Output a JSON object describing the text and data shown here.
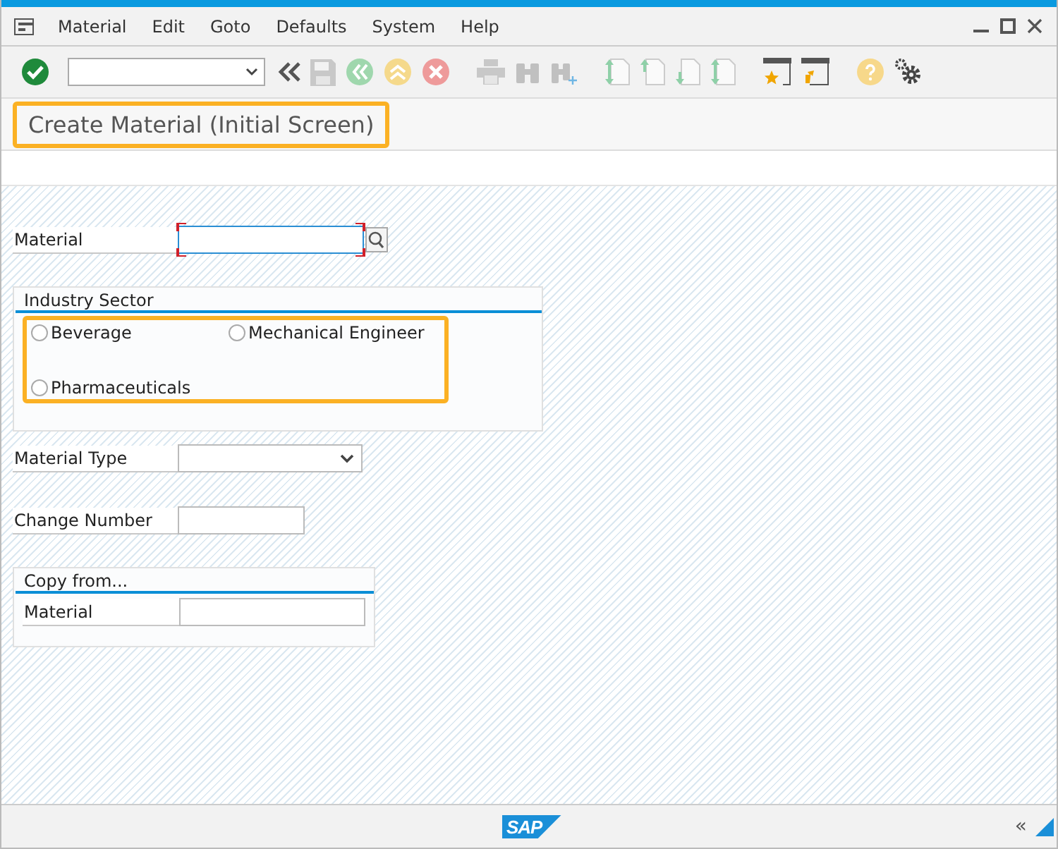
{
  "menu_bar": {
    "items": [
      "Material",
      "Edit",
      "Goto",
      "Defaults",
      "System",
      "Help"
    ]
  },
  "title": {
    "text": "Create Material (Initial Screen)",
    "highlighted": true
  },
  "form": {
    "material": {
      "label": "Material",
      "required": true
    },
    "industry_sector": {
      "title": "Industry Sector",
      "highlighted": true,
      "options": [
        {
          "label": "Beverage",
          "selected": false
        },
        {
          "label": "Mechanical Engineer",
          "selected": false
        },
        {
          "label": "Pharmaceuticals",
          "selected": false
        }
      ]
    },
    "material_type": {
      "label": "Material Type"
    },
    "change_number": {
      "label": "Change Number"
    },
    "copy_from": {
      "title": "Copy from...",
      "material": {
        "label": "Material"
      }
    }
  },
  "footer": {
    "logo": "SAP",
    "collapse": "«"
  }
}
